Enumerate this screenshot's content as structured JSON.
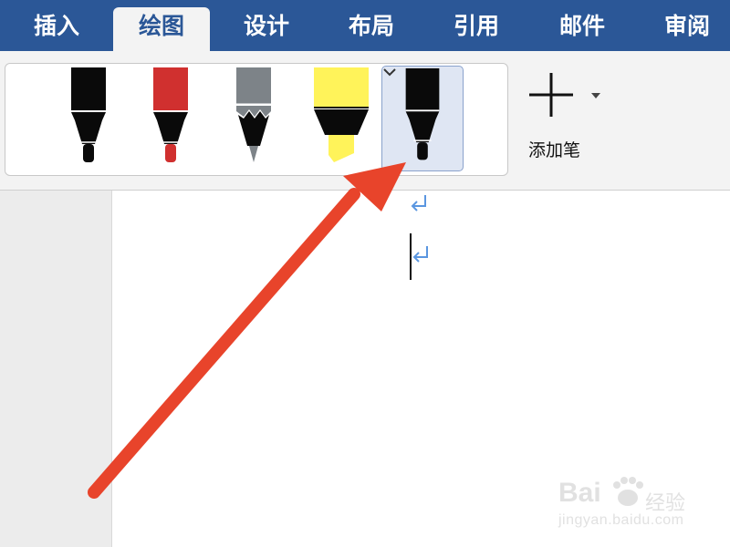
{
  "tabs": [
    {
      "label": "插入",
      "active": false
    },
    {
      "label": "绘图",
      "active": true
    },
    {
      "label": "设计",
      "active": false
    },
    {
      "label": "布局",
      "active": false
    },
    {
      "label": "引用",
      "active": false
    },
    {
      "label": "邮件",
      "active": false
    },
    {
      "label": "审阅",
      "active": false
    }
  ],
  "ribbon": {
    "pens": [
      {
        "name": "black-pen",
        "color": "#0a0a0a",
        "style": "pen"
      },
      {
        "name": "red-pen",
        "color": "#d0302f",
        "style": "pen"
      },
      {
        "name": "gray-pencil",
        "color": "#7d8388",
        "style": "pencil"
      },
      {
        "name": "yellow-highlighter",
        "color": "#fff35a",
        "style": "highlighter"
      },
      {
        "name": "black-pen-selected",
        "color": "#0a0a0a",
        "style": "pen",
        "selected": true
      }
    ],
    "add_pen": {
      "label": "添加笔",
      "icon": "plus-icon",
      "dropdown_icon": "dropdown-triangle-icon"
    }
  },
  "document": {
    "paragraph_mark_icon": "paragraph-mark-icon",
    "accent_color": "#5a96e0"
  },
  "annotation": {
    "arrow_color": "#e8442b"
  },
  "watermark": {
    "brand": "Bai",
    "brand_suffix": "经验",
    "url": "jingyan.baidu.com"
  },
  "colors": {
    "tabbar": "#2b5797",
    "ribbon": "#f3f3f3",
    "selection": "#dfe6f3"
  }
}
